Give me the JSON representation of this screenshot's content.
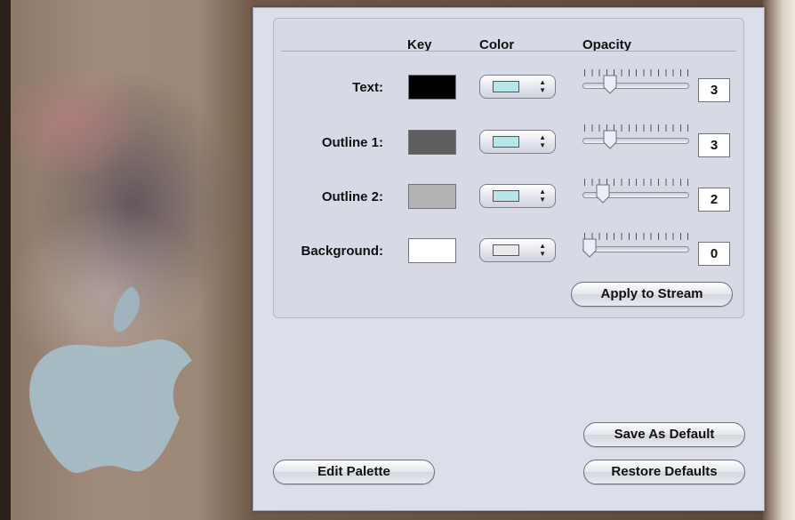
{
  "headers": {
    "key": "Key",
    "color": "Color",
    "opacity": "Opacity"
  },
  "rows": [
    {
      "label": "Text:",
      "key_color": "#000000",
      "chip_color": "#b8e6e8",
      "opacity": "3",
      "opacity_level": 3
    },
    {
      "label": "Outline 1:",
      "key_color": "#5e5e5e",
      "chip_color": "#b8e6e8",
      "opacity": "3",
      "opacity_level": 3
    },
    {
      "label": "Outline 2:",
      "key_color": "#b4b4b4",
      "chip_color": "#b8e6e8",
      "opacity": "2",
      "opacity_level": 2
    },
    {
      "label": "Background:",
      "key_color": "#ffffff",
      "chip_color": "#e9eae9",
      "opacity": "0",
      "opacity_level": 0
    }
  ],
  "buttons": {
    "apply": "Apply to Stream",
    "save_default": "Save As Default",
    "restore_defaults": "Restore Defaults",
    "edit_palette": "Edit Palette"
  }
}
